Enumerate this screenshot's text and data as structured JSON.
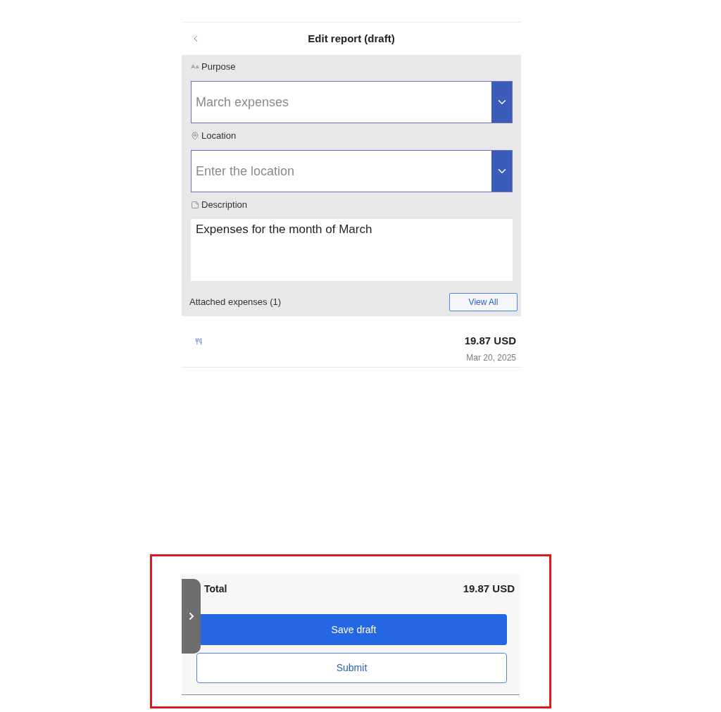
{
  "header": {
    "title": "Edit report (draft)"
  },
  "form": {
    "fields": [
      {
        "kind": "dropdown",
        "label": "Purpose",
        "placeholder": "March expenses"
      },
      {
        "kind": "dropdown",
        "label": "Location",
        "placeholder": "Enter the location"
      },
      {
        "kind": "textarea",
        "label": "Description",
        "value": "Expenses for the month of March"
      }
    ]
  },
  "attached": {
    "label": "Attached expenses (1)",
    "button": "View All"
  },
  "expenses": [
    {
      "amount": "19.87 USD",
      "date": "Mar 20, 2025"
    }
  ],
  "footer": {
    "total_label": "Total",
    "total_amount": "19.87 USD",
    "buttons": [
      {
        "kind": "primary",
        "label": "Save draft"
      },
      {
        "kind": "secondary",
        "label": "Submit"
      }
    ]
  }
}
